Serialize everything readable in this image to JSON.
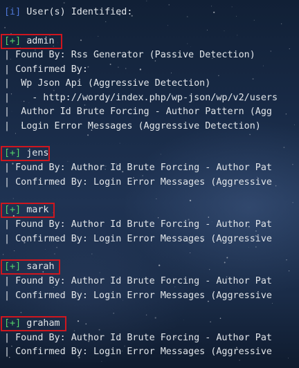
{
  "header": {
    "info_tag": "[i]",
    "title": "User(s) Identified:"
  },
  "tag_plus": "[+]",
  "pipe": "|",
  "users": [
    {
      "name": "admin",
      "found_by": "Found By: Rss Generator (Passive Detection)",
      "confirmed_by": "Confirmed By:",
      "confirmed_details": [
        "Wp Json Api (Aggressive Detection)",
        " - http://wordy/index.php/wp-json/wp/v2/users",
        "Author Id Brute Forcing - Author Pattern (Agg",
        "Login Error Messages (Aggressive Detection)"
      ]
    },
    {
      "name": "jens",
      "found_by": "Found By: Author Id Brute Forcing - Author Pat",
      "confirmed_by": "Confirmed By: Login Error Messages (Aggressive"
    },
    {
      "name": "mark",
      "found_by": "Found By: Author Id Brute Forcing - Author Pat",
      "confirmed_by": "Confirmed By: Login Error Messages (Aggressive"
    },
    {
      "name": "sarah",
      "found_by": "Found By: Author Id Brute Forcing - Author Pat",
      "confirmed_by": "Confirmed By: Login Error Messages (Aggressive"
    },
    {
      "name": "graham",
      "found_by": "Found By: Author Id Brute Forcing - Author Pat",
      "confirmed_by": "Confirmed By: Login Error Messages (Aggressive"
    }
  ],
  "colors": {
    "info_tag": "#4f78d8",
    "plus_tag": "#55d46a",
    "highlight_box": "#d0161e",
    "text": "#e2e6ea"
  }
}
